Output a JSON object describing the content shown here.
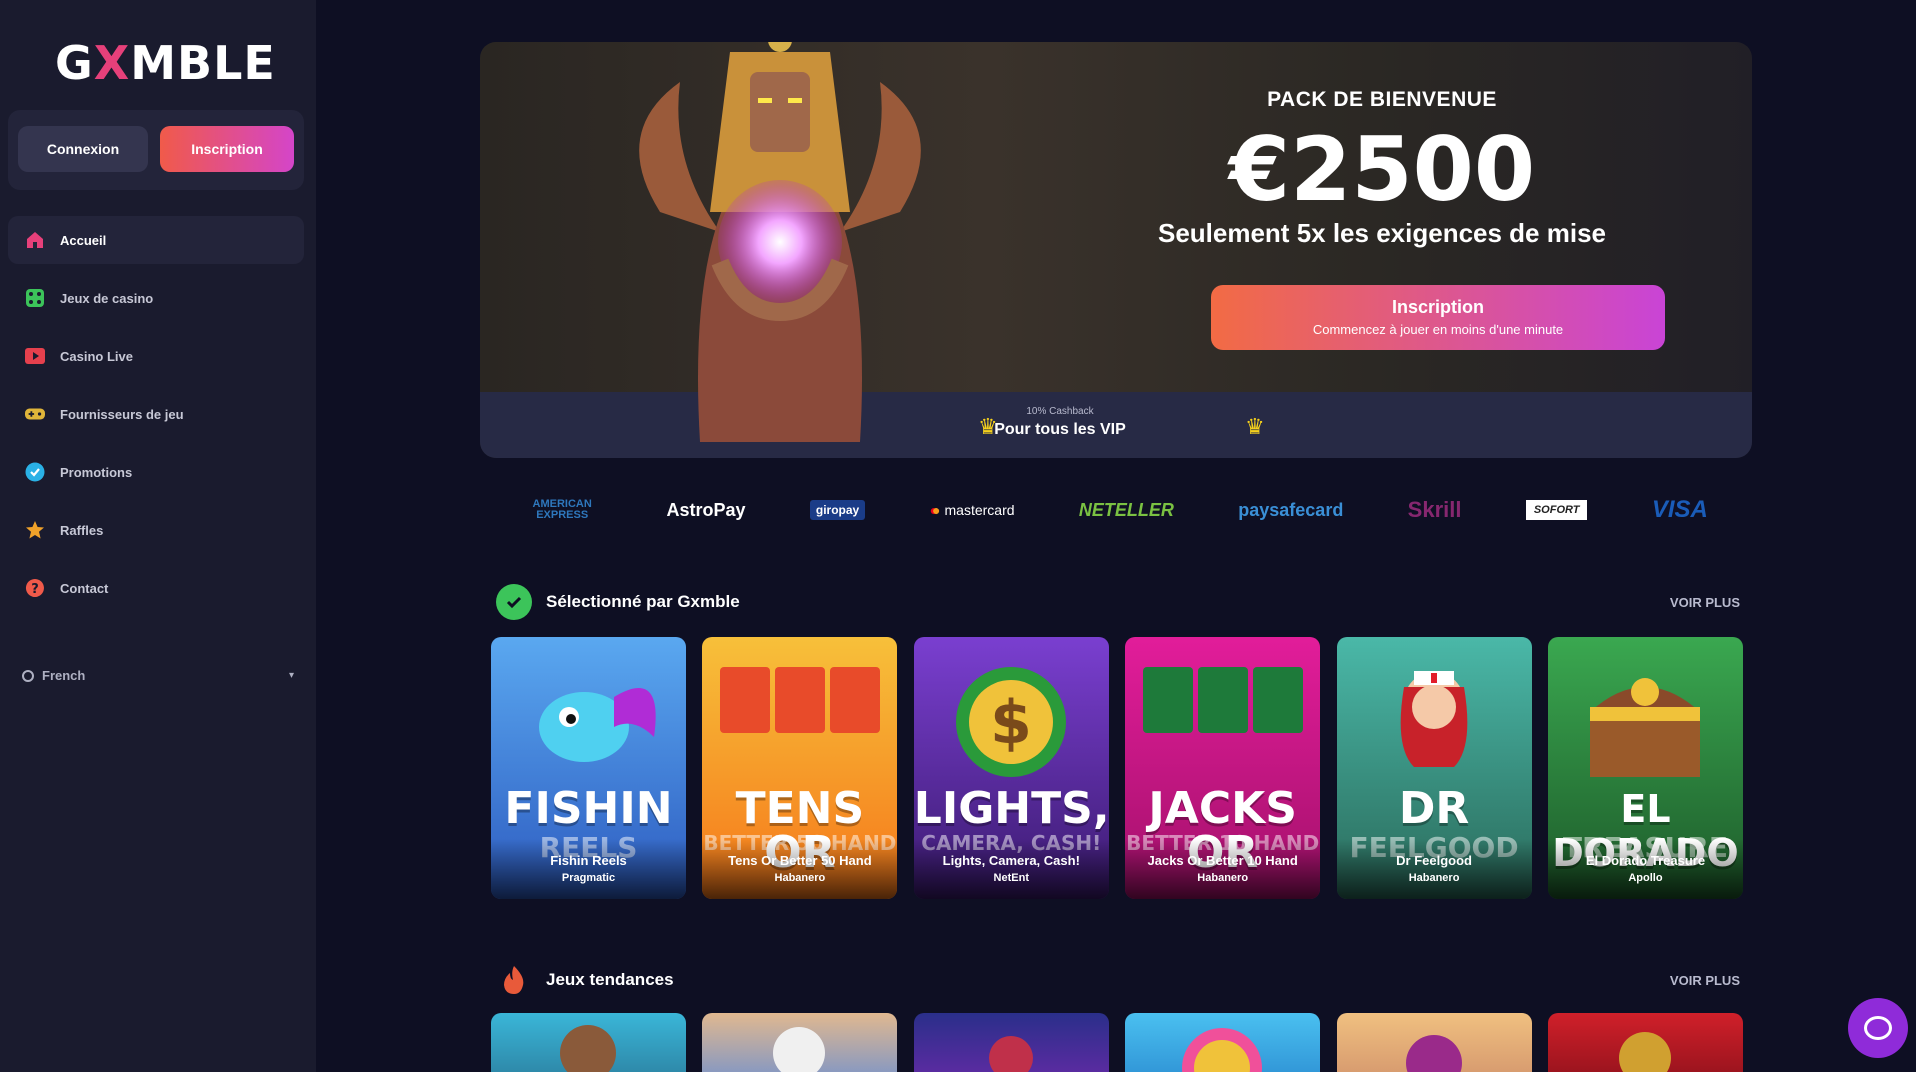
{
  "brand": {
    "name_left": "G",
    "name_x": "X",
    "name_right": "MBLE"
  },
  "auth": {
    "login_label": "Connexion",
    "signup_label": "Inscription"
  },
  "sidebar": {
    "items": [
      {
        "label": "Accueil",
        "icon": "home-icon",
        "color": "#e6407a"
      },
      {
        "label": "Jeux de casino",
        "icon": "dice-icon",
        "color": "#3cc45a"
      },
      {
        "label": "Casino Live",
        "icon": "play-icon",
        "color": "#e6404d"
      },
      {
        "label": "Fournisseurs de jeu",
        "icon": "gamepad-icon",
        "color": "#e0b53a"
      },
      {
        "label": "Promotions",
        "icon": "badge-check-icon",
        "color": "#2ab1e6"
      },
      {
        "label": "Raffles",
        "icon": "star-icon",
        "color": "#f0a22a"
      },
      {
        "label": "Contact",
        "icon": "help-icon",
        "color": "#f05a4a"
      }
    ],
    "language": "French"
  },
  "hero": {
    "title": "PACK DE BIENVENUE",
    "amount": "€2500",
    "subtitle": "Seulement 5x les exigences de mise",
    "cta_label": "Inscription",
    "cta_sub": "Commencez à jouer en moins d'une minute",
    "vip_small": "10% Cashback",
    "vip_big": "Pour tous les VIP"
  },
  "payments": [
    {
      "label": "AMERICAN EXPRESS",
      "color": "#2e77bc"
    },
    {
      "label": "AstroPay",
      "color": "#ffffff"
    },
    {
      "label": "giropay",
      "color": "#ffffff"
    },
    {
      "label": "mastercard",
      "color": "#ffffff"
    },
    {
      "label": "NETELLER",
      "color": "#7ac142"
    },
    {
      "label": "paysafecard",
      "color": "#3a8fd6"
    },
    {
      "label": "Skrill",
      "color": "#86276f"
    },
    {
      "label": "SOFORT",
      "color": "#ffffff"
    },
    {
      "label": "VISA",
      "color": "#1a5cb8"
    }
  ],
  "section1": {
    "title": "Sélectionné par Gxmble",
    "more": "VOIR PLUS",
    "games": [
      {
        "art1": "FISHIN",
        "art2": "REELS",
        "name": "Fishin Reels",
        "provider": "Pragmatic",
        "bg": "#3b80d9"
      },
      {
        "art1": "TENS OR",
        "art2": "BETTER 50 HAND",
        "name": "Tens Or Better 50 Hand",
        "provider": "Habanero",
        "bg": "#f29a1a"
      },
      {
        "art1": "LIGHTS,",
        "art2": "CAMERA, CASH!",
        "name": "Lights, Camera, Cash!",
        "provider": "NetEnt",
        "bg": "#6b2bb0"
      },
      {
        "art1": "JACKS OR",
        "art2": "BETTER 10 HAND",
        "name": "Jacks Or Better 10 Hand",
        "provider": "Habanero",
        "bg": "#d11f8f"
      },
      {
        "art1": "DR",
        "art2": "FEELGOOD",
        "name": "Dr Feelgood",
        "provider": "Habanero",
        "bg": "#3a9b8a"
      },
      {
        "art1": "EL DORADO",
        "art2": "TREASURE",
        "name": "El Dorado Treasure",
        "provider": "Apollo",
        "bg": "#2d8a3d"
      }
    ]
  },
  "section2": {
    "title": "Jeux tendances",
    "more": "VOIR PLUS",
    "games": [
      {
        "bg": "#2c9cc0"
      },
      {
        "bg": "#6c8fd0"
      },
      {
        "bg": "#3b3fa8"
      },
      {
        "bg": "#3aa8e8"
      },
      {
        "bg": "#e8b060"
      },
      {
        "bg": "#c81f2a"
      }
    ]
  }
}
